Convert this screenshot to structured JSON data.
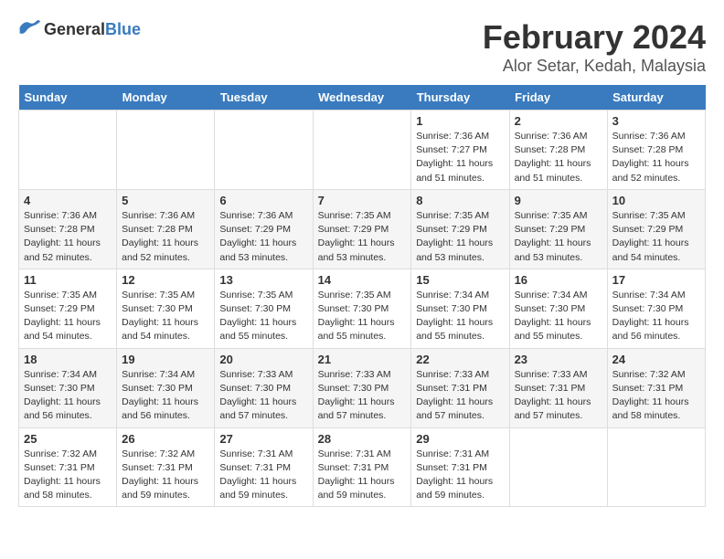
{
  "logo": {
    "general": "General",
    "blue": "Blue"
  },
  "title": "February 2024",
  "subtitle": "Alor Setar, Kedah, Malaysia",
  "headers": [
    "Sunday",
    "Monday",
    "Tuesday",
    "Wednesday",
    "Thursday",
    "Friday",
    "Saturday"
  ],
  "weeks": [
    [
      {
        "day": "",
        "info": ""
      },
      {
        "day": "",
        "info": ""
      },
      {
        "day": "",
        "info": ""
      },
      {
        "day": "",
        "info": ""
      },
      {
        "day": "1",
        "info": "Sunrise: 7:36 AM\nSunset: 7:27 PM\nDaylight: 11 hours\nand 51 minutes."
      },
      {
        "day": "2",
        "info": "Sunrise: 7:36 AM\nSunset: 7:28 PM\nDaylight: 11 hours\nand 51 minutes."
      },
      {
        "day": "3",
        "info": "Sunrise: 7:36 AM\nSunset: 7:28 PM\nDaylight: 11 hours\nand 52 minutes."
      }
    ],
    [
      {
        "day": "4",
        "info": "Sunrise: 7:36 AM\nSunset: 7:28 PM\nDaylight: 11 hours\nand 52 minutes."
      },
      {
        "day": "5",
        "info": "Sunrise: 7:36 AM\nSunset: 7:28 PM\nDaylight: 11 hours\nand 52 minutes."
      },
      {
        "day": "6",
        "info": "Sunrise: 7:36 AM\nSunset: 7:29 PM\nDaylight: 11 hours\nand 53 minutes."
      },
      {
        "day": "7",
        "info": "Sunrise: 7:35 AM\nSunset: 7:29 PM\nDaylight: 11 hours\nand 53 minutes."
      },
      {
        "day": "8",
        "info": "Sunrise: 7:35 AM\nSunset: 7:29 PM\nDaylight: 11 hours\nand 53 minutes."
      },
      {
        "day": "9",
        "info": "Sunrise: 7:35 AM\nSunset: 7:29 PM\nDaylight: 11 hours\nand 53 minutes."
      },
      {
        "day": "10",
        "info": "Sunrise: 7:35 AM\nSunset: 7:29 PM\nDaylight: 11 hours\nand 54 minutes."
      }
    ],
    [
      {
        "day": "11",
        "info": "Sunrise: 7:35 AM\nSunset: 7:29 PM\nDaylight: 11 hours\nand 54 minutes."
      },
      {
        "day": "12",
        "info": "Sunrise: 7:35 AM\nSunset: 7:30 PM\nDaylight: 11 hours\nand 54 minutes."
      },
      {
        "day": "13",
        "info": "Sunrise: 7:35 AM\nSunset: 7:30 PM\nDaylight: 11 hours\nand 55 minutes."
      },
      {
        "day": "14",
        "info": "Sunrise: 7:35 AM\nSunset: 7:30 PM\nDaylight: 11 hours\nand 55 minutes."
      },
      {
        "day": "15",
        "info": "Sunrise: 7:34 AM\nSunset: 7:30 PM\nDaylight: 11 hours\nand 55 minutes."
      },
      {
        "day": "16",
        "info": "Sunrise: 7:34 AM\nSunset: 7:30 PM\nDaylight: 11 hours\nand 55 minutes."
      },
      {
        "day": "17",
        "info": "Sunrise: 7:34 AM\nSunset: 7:30 PM\nDaylight: 11 hours\nand 56 minutes."
      }
    ],
    [
      {
        "day": "18",
        "info": "Sunrise: 7:34 AM\nSunset: 7:30 PM\nDaylight: 11 hours\nand 56 minutes."
      },
      {
        "day": "19",
        "info": "Sunrise: 7:34 AM\nSunset: 7:30 PM\nDaylight: 11 hours\nand 56 minutes."
      },
      {
        "day": "20",
        "info": "Sunrise: 7:33 AM\nSunset: 7:30 PM\nDaylight: 11 hours\nand 57 minutes."
      },
      {
        "day": "21",
        "info": "Sunrise: 7:33 AM\nSunset: 7:30 PM\nDaylight: 11 hours\nand 57 minutes."
      },
      {
        "day": "22",
        "info": "Sunrise: 7:33 AM\nSunset: 7:31 PM\nDaylight: 11 hours\nand 57 minutes."
      },
      {
        "day": "23",
        "info": "Sunrise: 7:33 AM\nSunset: 7:31 PM\nDaylight: 11 hours\nand 57 minutes."
      },
      {
        "day": "24",
        "info": "Sunrise: 7:32 AM\nSunset: 7:31 PM\nDaylight: 11 hours\nand 58 minutes."
      }
    ],
    [
      {
        "day": "25",
        "info": "Sunrise: 7:32 AM\nSunset: 7:31 PM\nDaylight: 11 hours\nand 58 minutes."
      },
      {
        "day": "26",
        "info": "Sunrise: 7:32 AM\nSunset: 7:31 PM\nDaylight: 11 hours\nand 59 minutes."
      },
      {
        "day": "27",
        "info": "Sunrise: 7:31 AM\nSunset: 7:31 PM\nDaylight: 11 hours\nand 59 minutes."
      },
      {
        "day": "28",
        "info": "Sunrise: 7:31 AM\nSunset: 7:31 PM\nDaylight: 11 hours\nand 59 minutes."
      },
      {
        "day": "29",
        "info": "Sunrise: 7:31 AM\nSunset: 7:31 PM\nDaylight: 11 hours\nand 59 minutes."
      },
      {
        "day": "",
        "info": ""
      },
      {
        "day": "",
        "info": ""
      }
    ]
  ]
}
